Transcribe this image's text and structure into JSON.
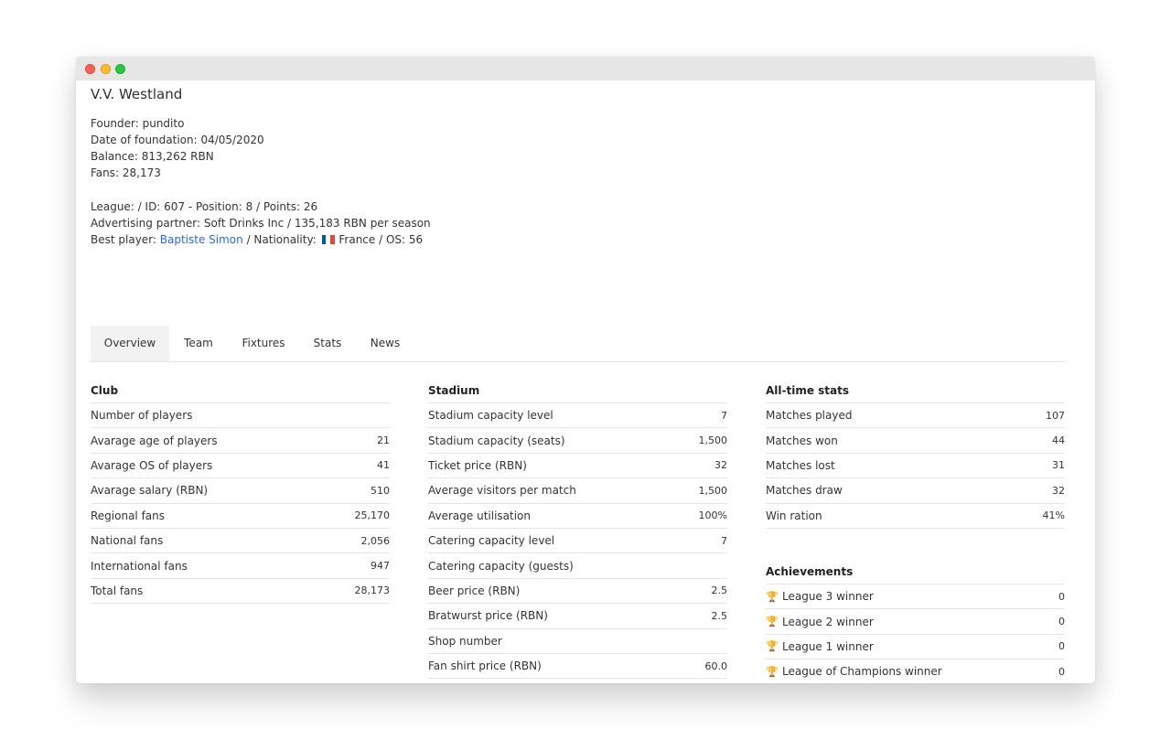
{
  "club": {
    "name": "V.V. Westland",
    "founder": "Founder: pundito",
    "foundation": "Date of foundation: 04/05/2020",
    "balance": "Balance: 813,262 RBN",
    "fans": "Fans: 28,173",
    "league": "League: / ID: 607 - Position: 8 / Points: 26",
    "advertising": "Advertising partner: Soft Drinks Inc / 135,183 RBN per season",
    "best_player_prefix": "Best player: ",
    "best_player_name": "Baptiste Simon",
    "nationality_prefix": " / Nationality: ",
    "nationality_suffix": " France / OS: 56",
    "flag_colors": [
      "#0055a4",
      "#ffffff",
      "#ef4135"
    ],
    "link_color": "#2962ff"
  },
  "tabs": [
    {
      "label": "Overview",
      "active": true
    },
    {
      "label": "Team",
      "active": false
    },
    {
      "label": "Fixtures",
      "active": false
    },
    {
      "label": "Stats",
      "active": false
    },
    {
      "label": "News",
      "active": false
    }
  ],
  "club_table": {
    "title": "Club",
    "rows": [
      {
        "label": "Number of players",
        "value": ""
      },
      {
        "label": "Avarage age of players",
        "value": "21"
      },
      {
        "label": "Avarage OS of players",
        "value": "41"
      },
      {
        "label": "Avarage salary (RBN)",
        "value": "510"
      },
      {
        "label": "Regional fans",
        "value": "25,170"
      },
      {
        "label": "National fans",
        "value": "2,056"
      },
      {
        "label": "International fans",
        "value": "947"
      },
      {
        "label": "Total fans",
        "value": "28,173"
      }
    ]
  },
  "stadium_table": {
    "title": "Stadium",
    "rows": [
      {
        "label": "Stadium capacity level",
        "value": "7"
      },
      {
        "label": "Stadium capacity (seats)",
        "value": "1,500"
      },
      {
        "label": "Ticket price (RBN)",
        "value": "32"
      },
      {
        "label": "Average visitors per match",
        "value": "1,500"
      },
      {
        "label": "Average utilisation",
        "value": "100%"
      },
      {
        "label": "Catering capacity level",
        "value": "7"
      },
      {
        "label": "Catering capacity (guests)",
        "value": ""
      },
      {
        "label": "Beer price (RBN)",
        "value": "2.5"
      },
      {
        "label": "Bratwurst price (RBN)",
        "value": "2.5"
      },
      {
        "label": "Shop number",
        "value": ""
      },
      {
        "label": "Fan shirt price (RBN)",
        "value": "60.0"
      }
    ]
  },
  "alltime_table": {
    "title": "All-time stats",
    "rows": [
      {
        "label": "Matches played",
        "value": "107"
      },
      {
        "label": "Matches won",
        "value": "44"
      },
      {
        "label": "Matches lost",
        "value": "31"
      },
      {
        "label": "Matches draw",
        "value": "32"
      },
      {
        "label": "Win ration",
        "value": "41%"
      }
    ]
  },
  "achievements_table": {
    "title": "Achievements",
    "rows": [
      {
        "label": "League 3 winner",
        "value": "0",
        "icon": "trophy-bronze-icon",
        "color": "#8a7a6a"
      },
      {
        "label": "League 2 winner",
        "value": "0",
        "icon": "trophy-copper-icon",
        "color": "#c98a72"
      },
      {
        "label": "League 1 winner",
        "value": "0",
        "icon": "trophy-silver-icon",
        "color": "#c8c8c8"
      },
      {
        "label": "League of Champions winner",
        "value": "0",
        "icon": "trophy-gold-icon",
        "color": "#e0b020"
      }
    ]
  }
}
